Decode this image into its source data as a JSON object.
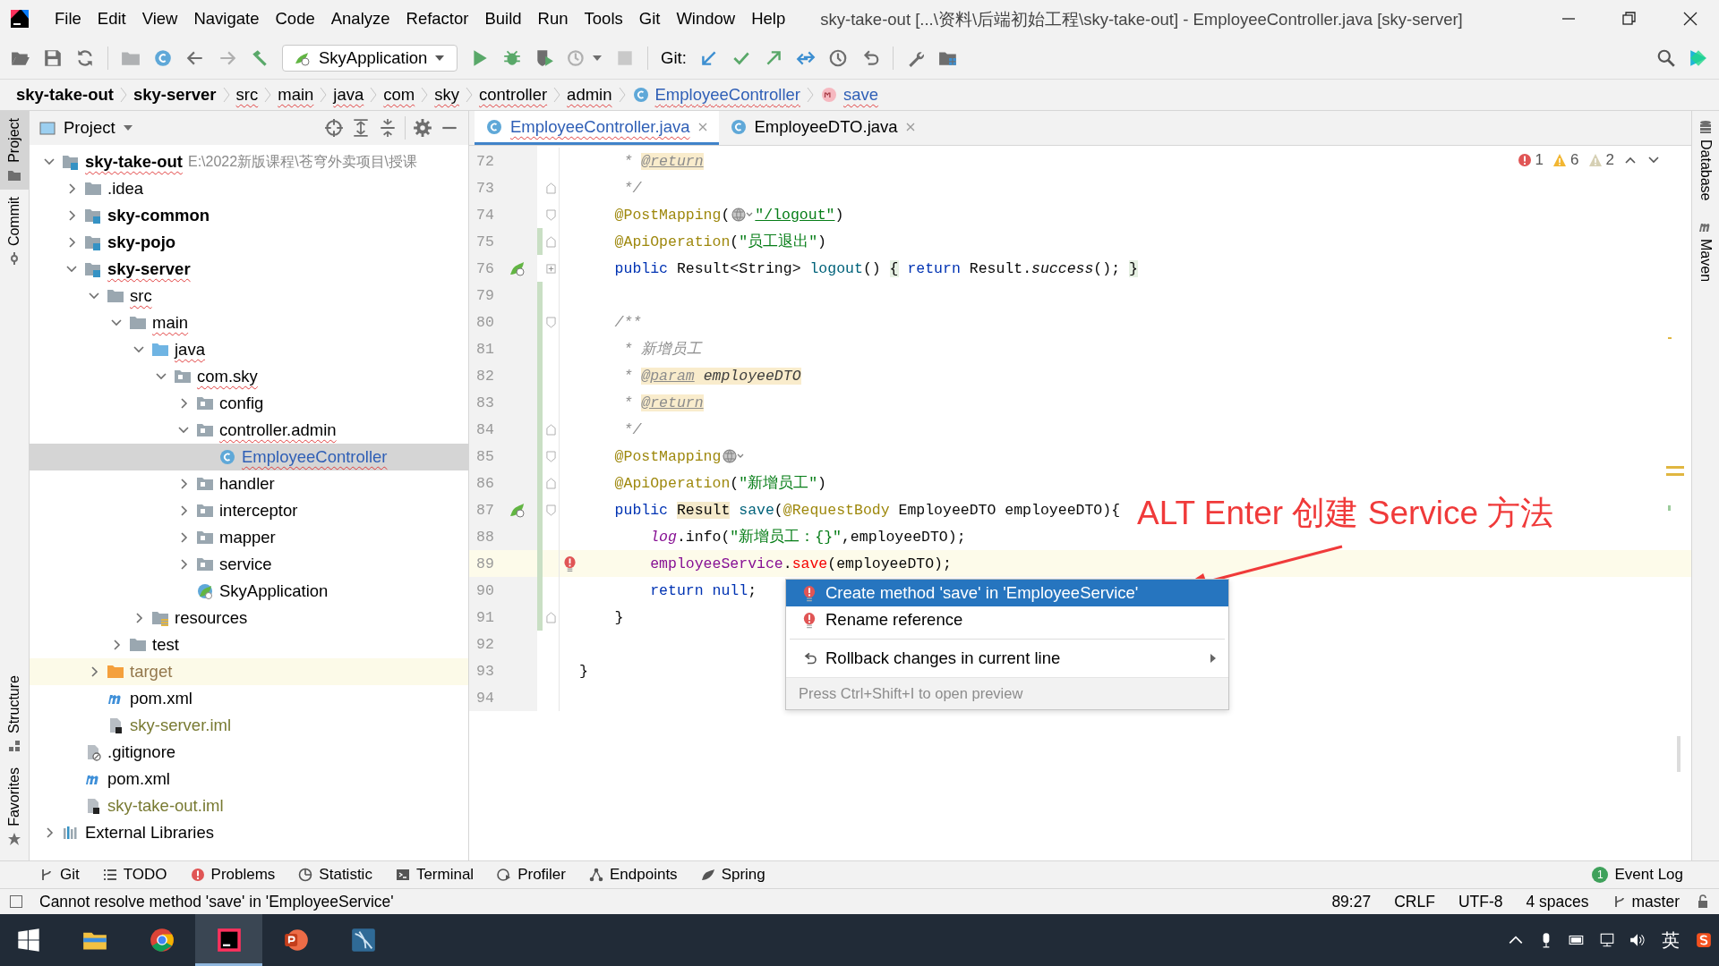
{
  "window": {
    "title": "sky-take-out [...\\资料\\后端初始工程\\sky-take-out] - EmployeeController.java [sky-server]"
  },
  "menu": [
    "File",
    "Edit",
    "View",
    "Navigate",
    "Code",
    "Analyze",
    "Refactor",
    "Build",
    "Run",
    "Tools",
    "Git",
    "Window",
    "Help"
  ],
  "toolbar": {
    "run_config": "SkyApplication",
    "vcs_label": "Git:"
  },
  "breadcrumbs": [
    {
      "label": "sky-take-out",
      "kind": "module",
      "error": false
    },
    {
      "label": "sky-server",
      "kind": "module",
      "error": false
    },
    {
      "label": "src",
      "kind": "folder",
      "error": true
    },
    {
      "label": "main",
      "kind": "folder",
      "error": true
    },
    {
      "label": "java",
      "kind": "folder",
      "error": true
    },
    {
      "label": "com",
      "kind": "folder",
      "error": true
    },
    {
      "label": "sky",
      "kind": "folder",
      "error": true
    },
    {
      "label": "controller",
      "kind": "folder",
      "error": true
    },
    {
      "label": "admin",
      "kind": "folder",
      "error": true
    },
    {
      "label": "EmployeeController",
      "kind": "class",
      "error": true
    },
    {
      "label": "save",
      "kind": "method",
      "error": true
    }
  ],
  "left_tool_windows": [
    {
      "label": "Project",
      "kind": "project",
      "selected": true
    },
    {
      "label": "Commit",
      "kind": "commit",
      "selected": false
    },
    {
      "label": "Structure",
      "kind": "structure",
      "selected": false
    },
    {
      "label": "Favorites",
      "kind": "favorites",
      "selected": false
    }
  ],
  "right_tool_windows": [
    {
      "label": "Database",
      "kind": "database"
    },
    {
      "label": "Maven",
      "kind": "maven"
    }
  ],
  "project_panel": {
    "title": "Project",
    "tree": [
      {
        "label": "sky-take-out",
        "kind": "module",
        "note": "E:\\2022新版课程\\苍穹外卖项目\\授课",
        "expanded": true,
        "selected": false,
        "error": true,
        "children": [
          {
            "label": ".idea",
            "kind": "folder",
            "expanded": false,
            "selected": false,
            "error": false
          },
          {
            "label": "sky-common",
            "kind": "module",
            "expanded": false,
            "selected": false,
            "error": false
          },
          {
            "label": "sky-pojo",
            "kind": "module",
            "expanded": false,
            "selected": false,
            "error": false
          },
          {
            "label": "sky-server",
            "kind": "module",
            "expanded": true,
            "selected": false,
            "error": true,
            "children": [
              {
                "label": "src",
                "kind": "folder",
                "expanded": true,
                "selected": false,
                "error": true,
                "children": [
                  {
                    "label": "main",
                    "kind": "folder",
                    "expanded": true,
                    "selected": false,
                    "error": true,
                    "children": [
                      {
                        "label": "java",
                        "kind": "source-folder",
                        "expanded": true,
                        "selected": false,
                        "error": true,
                        "children": [
                          {
                            "label": "com.sky",
                            "kind": "package",
                            "expanded": true,
                            "selected": false,
                            "error": true,
                            "children": [
                              {
                                "label": "config",
                                "kind": "package",
                                "expanded": false,
                                "selected": false,
                                "error": false
                              },
                              {
                                "label": "controller.admin",
                                "kind": "package",
                                "expanded": true,
                                "selected": false,
                                "error": true,
                                "children": [
                                  {
                                    "label": "EmployeeController",
                                    "kind": "class",
                                    "selected": true,
                                    "error": true
                                  }
                                ]
                              },
                              {
                                "label": "handler",
                                "kind": "package",
                                "expanded": false,
                                "selected": false,
                                "error": false
                              },
                              {
                                "label": "interceptor",
                                "kind": "package",
                                "expanded": false,
                                "selected": false,
                                "error": false
                              },
                              {
                                "label": "mapper",
                                "kind": "package",
                                "expanded": false,
                                "selected": false,
                                "error": false
                              },
                              {
                                "label": "service",
                                "kind": "package",
                                "expanded": false,
                                "selected": false,
                                "error": false
                              },
                              {
                                "label": "SkyApplication",
                                "kind": "app-class",
                                "selected": false,
                                "error": false
                              }
                            ]
                          }
                        ]
                      },
                      {
                        "label": "resources",
                        "kind": "resources",
                        "expanded": false,
                        "selected": false,
                        "error": false
                      }
                    ]
                  },
                  {
                    "label": "test",
                    "kind": "folder",
                    "expanded": false,
                    "selected": false,
                    "error": false
                  }
                ]
              },
              {
                "label": "target",
                "kind": "excluded",
                "expanded": false,
                "selected": false,
                "error": false
              },
              {
                "label": "pom.xml",
                "kind": "maven",
                "selected": false,
                "error": false
              },
              {
                "label": "sky-server.iml",
                "kind": "iml",
                "selected": false,
                "error": false
              }
            ]
          },
          {
            "label": ".gitignore",
            "kind": "ignore",
            "selected": false,
            "error": false
          },
          {
            "label": "pom.xml",
            "kind": "maven",
            "selected": false,
            "error": false
          },
          {
            "label": "sky-take-out.iml",
            "kind": "iml",
            "selected": false,
            "error": false
          }
        ]
      },
      {
        "label": "External Libraries",
        "kind": "libraries",
        "expanded": false,
        "selected": false,
        "error": false
      }
    ]
  },
  "editor": {
    "tabs": [
      {
        "label": "EmployeeController.java",
        "selected": true,
        "error": true
      },
      {
        "label": "EmployeeDTO.java",
        "selected": false,
        "error": false
      }
    ],
    "inspections": [
      {
        "kind": "error",
        "count": "1"
      },
      {
        "kind": "warning",
        "count": "6"
      },
      {
        "kind": "weak",
        "count": "2"
      }
    ],
    "lines": [
      {
        "number": "72",
        "changed": false,
        "current": false,
        "tokens": [
          {
            "kind": "doc",
            "text": "     * "
          },
          {
            "kind": "doctag",
            "text": "@return"
          }
        ]
      },
      {
        "number": "73",
        "changed": false,
        "current": false,
        "gutter": [
          {
            "kind": "fold-end"
          }
        ],
        "tokens": [
          {
            "kind": "doc",
            "text": "     */"
          }
        ]
      },
      {
        "number": "74",
        "changed": false,
        "current": false,
        "gutter": [
          {
            "kind": "fold-start"
          }
        ],
        "tokens": [
          {
            "kind": "ann",
            "text": "    @PostMapping"
          },
          {
            "kind": "plain",
            "text": "("
          },
          {
            "kind": "globe"
          },
          {
            "kind": "url",
            "text": "\"/logout\""
          },
          {
            "kind": "plain",
            "text": ")"
          }
        ]
      },
      {
        "number": "75",
        "changed": true,
        "current": false,
        "gutter": [
          {
            "kind": "fold-end"
          }
        ],
        "tokens": [
          {
            "kind": "ann",
            "text": "    @ApiOperation"
          },
          {
            "kind": "plain",
            "text": "("
          },
          {
            "kind": "str",
            "text": "\"员工退出\""
          },
          {
            "kind": "plain",
            "text": ")"
          }
        ]
      },
      {
        "number": "76",
        "changed": false,
        "current": false,
        "gutter": [
          {
            "kind": "endpoint"
          },
          {
            "kind": "folded"
          }
        ],
        "tokens": [
          {
            "kind": "kw",
            "text": "    public"
          },
          {
            "kind": "plain",
            "text": " Result<String> "
          },
          {
            "kind": "fn",
            "text": "logout"
          },
          {
            "kind": "plain",
            "text": "() "
          },
          {
            "kind": "fold",
            "text": "{"
          },
          {
            "kind": "kw",
            "text": " return"
          },
          {
            "kind": "plain",
            "text": " Result."
          },
          {
            "kind": "static",
            "text": "success"
          },
          {
            "kind": "plain",
            "text": "(); "
          },
          {
            "kind": "fold",
            "text": "}"
          }
        ]
      },
      {
        "number": "79",
        "changed": true,
        "current": false
      },
      {
        "number": "80",
        "changed": true,
        "current": false,
        "gutter": [
          {
            "kind": "fold-start"
          }
        ],
        "tokens": [
          {
            "kind": "doc",
            "text": "    /**"
          }
        ]
      },
      {
        "number": "81",
        "changed": true,
        "current": false,
        "tokens": [
          {
            "kind": "doc",
            "text": "     * 新增员工"
          }
        ]
      },
      {
        "number": "82",
        "changed": true,
        "current": false,
        "tokens": [
          {
            "kind": "doc",
            "text": "     * "
          },
          {
            "kind": "doctag",
            "text": "@param"
          },
          {
            "kind": "docref",
            "text": " employeeDTO"
          }
        ]
      },
      {
        "number": "83",
        "changed": true,
        "current": false,
        "tokens": [
          {
            "kind": "doc",
            "text": "     * "
          },
          {
            "kind": "doctag",
            "text": "@return"
          }
        ]
      },
      {
        "number": "84",
        "changed": true,
        "current": false,
        "gutter": [
          {
            "kind": "fold-end"
          }
        ],
        "tokens": [
          {
            "kind": "doc",
            "text": "     */"
          }
        ]
      },
      {
        "number": "85",
        "changed": true,
        "current": false,
        "gutter": [
          {
            "kind": "fold-start"
          }
        ],
        "tokens": [
          {
            "kind": "ann",
            "text": "    @PostMapping"
          },
          {
            "kind": "globe"
          }
        ]
      },
      {
        "number": "86",
        "changed": true,
        "current": false,
        "gutter": [
          {
            "kind": "fold-end"
          }
        ],
        "tokens": [
          {
            "kind": "ann",
            "text": "    @ApiOperation"
          },
          {
            "kind": "plain",
            "text": "("
          },
          {
            "kind": "str",
            "text": "\"新增员工\""
          },
          {
            "kind": "plain",
            "text": ")"
          }
        ]
      },
      {
        "number": "87",
        "changed": true,
        "current": false,
        "gutter": [
          {
            "kind": "endpoint"
          },
          {
            "kind": "fold-start"
          }
        ],
        "tokens": [
          {
            "kind": "kw",
            "text": "    public "
          },
          {
            "kind": "usage",
            "text": "Result"
          },
          {
            "kind": "fn",
            "text": " save"
          },
          {
            "kind": "plain",
            "text": "("
          },
          {
            "kind": "ann",
            "text": "@RequestBody"
          },
          {
            "kind": "plain",
            "text": " EmployeeDTO employeeDTO){"
          }
        ]
      },
      {
        "number": "88",
        "changed": true,
        "current": false,
        "tokens": [
          {
            "kind": "static-field",
            "text": "        log"
          },
          {
            "kind": "plain",
            "text": ".info("
          },
          {
            "kind": "str",
            "text": "\"新增员工：{}\""
          },
          {
            "kind": "plain",
            "text": ",employeeDTO);"
          }
        ]
      },
      {
        "number": "89",
        "changed": true,
        "current": true,
        "gutter": [
          {
            "kind": "error"
          }
        ],
        "tokens": [
          {
            "kind": "field",
            "text": "        employeeService"
          },
          {
            "kind": "plain",
            "text": "."
          },
          {
            "kind": "unresolved",
            "text": "save"
          },
          {
            "kind": "plain",
            "text": "(employeeDTO);"
          }
        ]
      },
      {
        "number": "90",
        "changed": true,
        "current": false,
        "tokens": [
          {
            "kind": "kw",
            "text": "        return null"
          },
          {
            "kind": "plain",
            "text": ";"
          }
        ]
      },
      {
        "number": "91",
        "changed": true,
        "current": false,
        "gutter": [
          {
            "kind": "fold-end"
          }
        ],
        "tokens": [
          {
            "kind": "plain",
            "text": "    }"
          }
        ]
      },
      {
        "number": "92",
        "changed": false,
        "current": false
      },
      {
        "number": "93",
        "changed": false,
        "current": false,
        "tokens": [
          {
            "kind": "plain",
            "text": "}"
          }
        ]
      },
      {
        "number": "94",
        "changed": false,
        "current": false
      }
    ],
    "popup": {
      "items": [
        {
          "label": "Create method 'save' in 'EmployeeService'",
          "kind": "error",
          "selected": true,
          "submenu": false
        },
        {
          "label": "Rename reference",
          "kind": "error",
          "selected": false,
          "submenu": false
        },
        {
          "label": "Rollback changes in current line",
          "kind": "rollback",
          "selected": false,
          "submenu": true
        }
      ],
      "hint": "Press Ctrl+Shift+I to open preview"
    }
  },
  "annotation": "ALT Enter 创建 Service 方法",
  "bottom_tools": [
    {
      "label": "Git",
      "kind": "git"
    },
    {
      "label": "TODO",
      "kind": "todo"
    },
    {
      "label": "Problems",
      "kind": "problems"
    },
    {
      "label": "Statistic",
      "kind": "statistic"
    },
    {
      "label": "Terminal",
      "kind": "terminal"
    },
    {
      "label": "Profiler",
      "kind": "profiler"
    },
    {
      "label": "Endpoints",
      "kind": "endpoints"
    },
    {
      "label": "Spring",
      "kind": "spring"
    }
  ],
  "event_log": {
    "label": "Event Log",
    "badge": "1"
  },
  "status_bar": {
    "message": "Cannot resolve method 'save' in 'EmployeeService'",
    "items": [
      "89:27",
      "CRLF",
      "UTF-8",
      "4 spaces"
    ],
    "branch": "master"
  },
  "taskbar": {
    "apps": [
      {
        "kind": "explorer",
        "selected": false
      },
      {
        "kind": "chrome",
        "selected": false
      },
      {
        "kind": "intellij",
        "selected": true
      },
      {
        "kind": "powerpoint",
        "selected": false
      },
      {
        "kind": "workbench",
        "selected": false
      }
    ],
    "ime": "英"
  }
}
